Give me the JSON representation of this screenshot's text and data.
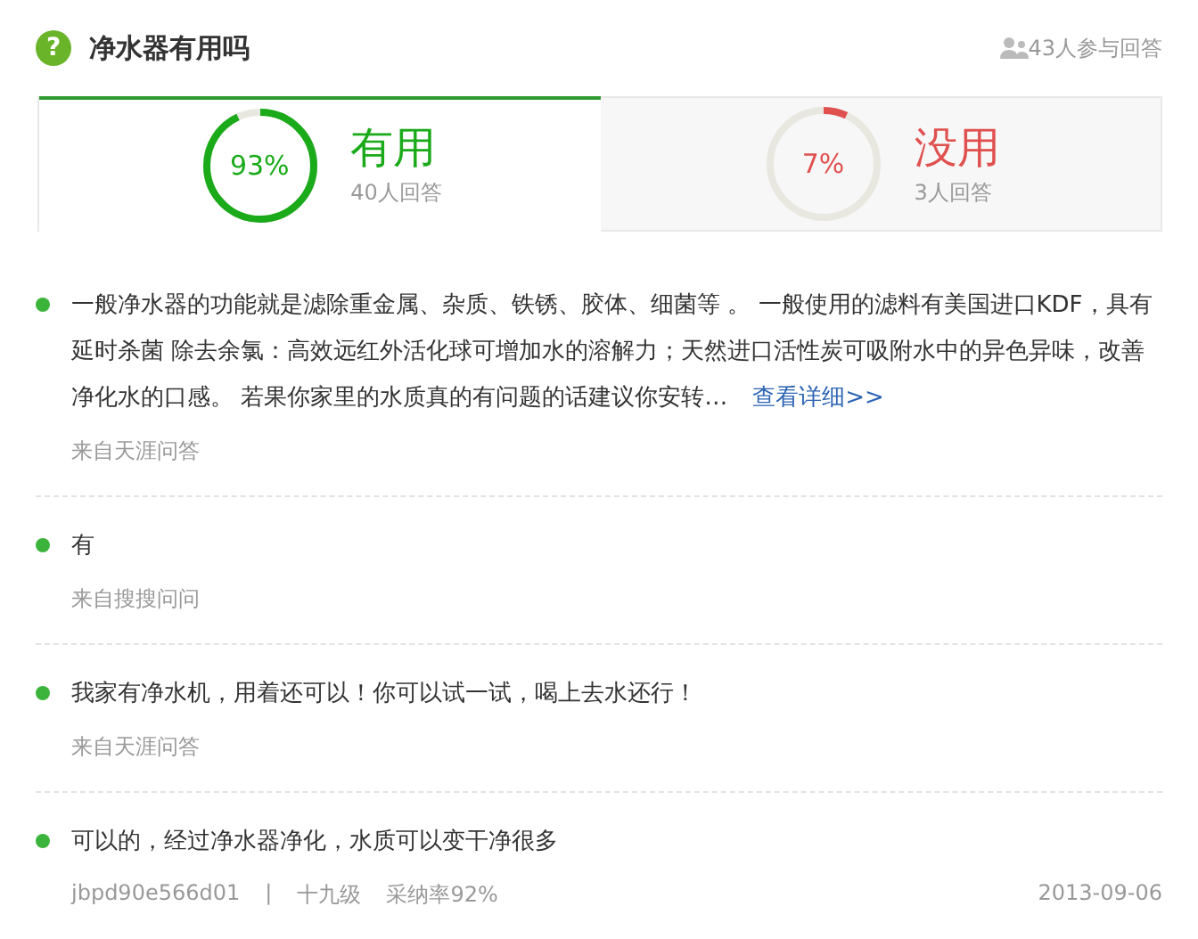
{
  "question": {
    "icon": "?",
    "title": "净水器有用吗",
    "participants": "43人参与回答"
  },
  "votes": [
    {
      "kind": "useful",
      "percent": "93%",
      "level": 0.93,
      "label": "有用",
      "count": "40人回答",
      "selected": true
    },
    {
      "kind": "useless",
      "percent": "7%",
      "level": 0.07,
      "label": "没用",
      "count": "3人回答",
      "selected": false
    }
  ],
  "answers": [
    {
      "kind": "source",
      "text": "一般净水器的功能就是滤除重金属、杂质、铁锈、胶体、细菌等 。 一般使用的滤料有美国进口KDF，具有延时杀菌 除去余氯：高效远红外活化球可增加水的溶解力；天然进口活性炭可吸附水中的异色异味，改善净化水的口感。 若果你家里的水质真的有问题的话建议你安转…",
      "more": "查看详细>>",
      "source": "来自天涯问答"
    },
    {
      "kind": "source",
      "text": "有",
      "source": "来自搜搜问问"
    },
    {
      "kind": "source",
      "text": "我家有净水机，用着还可以！你可以试一试，喝上去水还行！",
      "source": "来自天涯问答"
    },
    {
      "kind": "user",
      "text": "可以的，经过净水器净化，水质可以变干净很多",
      "user": "jbpd90e566d01",
      "separator": "|",
      "grade": "十九级",
      "rate": "采纳率92%",
      "date": "2013-09-06"
    }
  ]
}
